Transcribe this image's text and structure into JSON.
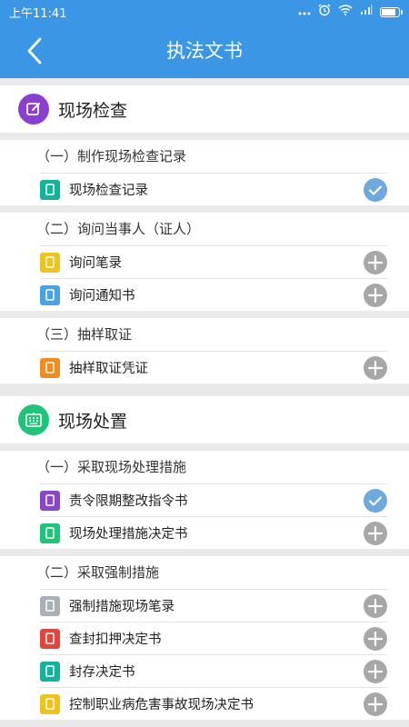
{
  "statusbar": {
    "time": "上午11:41"
  },
  "header": {
    "title": "执法文书"
  },
  "colors": {
    "primary": "#3c96e6",
    "check": "#6fa8dc",
    "add": "#a7a7a7",
    "sec1": "#8a3fd1",
    "sec2": "#1fc47a"
  },
  "sections": [
    {
      "title": "现场检查",
      "icon": "edit-icon",
      "groups": [
        {
          "title": "（一）制作现场检查记录",
          "items": [
            {
              "label": "现场检查记录",
              "state": "checked",
              "color": "#13b39a"
            }
          ]
        },
        {
          "title": "（二）询问当事人（证人）",
          "items": [
            {
              "label": "询问笔录",
              "state": "add",
              "color": "#f0c21c"
            },
            {
              "label": "询问通知书",
              "state": "add",
              "color": "#4ba1e6"
            }
          ]
        },
        {
          "title": "（三）抽样取证",
          "items": [
            {
              "label": "抽样取证凭证",
              "state": "add",
              "color": "#f08b1d"
            }
          ]
        }
      ]
    },
    {
      "title": "现场处置",
      "icon": "keyboard-icon",
      "groups": [
        {
          "title": "（一）采取现场处理措施",
          "items": [
            {
              "label": "责令限期整改指令书",
              "state": "checked",
              "color": "#8a46c7"
            },
            {
              "label": "现场处理措施决定书",
              "state": "add",
              "color": "#1fc47a"
            }
          ]
        },
        {
          "title": "（二）采取强制措施",
          "items": [
            {
              "label": "强制措施现场笔录",
              "state": "add",
              "color": "#aab0b5"
            },
            {
              "label": "查封扣押决定书",
              "state": "add",
              "color": "#e0463c"
            },
            {
              "label": "封存决定书",
              "state": "add",
              "color": "#13b39a"
            },
            {
              "label": "控制职业病危害事故现场决定书",
              "state": "add",
              "color": "#f0c21c"
            }
          ]
        }
      ]
    }
  ]
}
